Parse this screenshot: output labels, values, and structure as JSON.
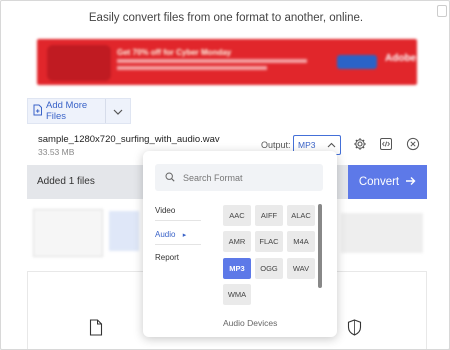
{
  "header": {
    "tagline": "Easily convert files from one format to another, online."
  },
  "ad": {
    "headline": "Get 70% off for Cyber Monday",
    "brand": "Adobe"
  },
  "toolbar": {
    "add_files_label": "Add More Files"
  },
  "file": {
    "name": "sample_1280x720_surfing_with_audio.wav",
    "size": "33.53 MB"
  },
  "output": {
    "label": "Output:",
    "selected": "MP3"
  },
  "status": {
    "added_text": "Added 1 files",
    "convert_label": "Convert"
  },
  "format_menu": {
    "search_placeholder": "Search Format",
    "categories": [
      {
        "label": "Video"
      },
      {
        "label": "Audio"
      },
      {
        "label": "Report"
      }
    ],
    "formats": [
      "AAC",
      "AIFF",
      "ALAC",
      "AMR",
      "FLAC",
      "M4A",
      "MP3",
      "OGG",
      "WAV",
      "WMA"
    ],
    "selected_format": "MP3",
    "footer_label": "Audio Devices"
  },
  "colors": {
    "accent": "#5d79e8",
    "link": "#3a63c8",
    "ad_red": "#e1262b"
  }
}
